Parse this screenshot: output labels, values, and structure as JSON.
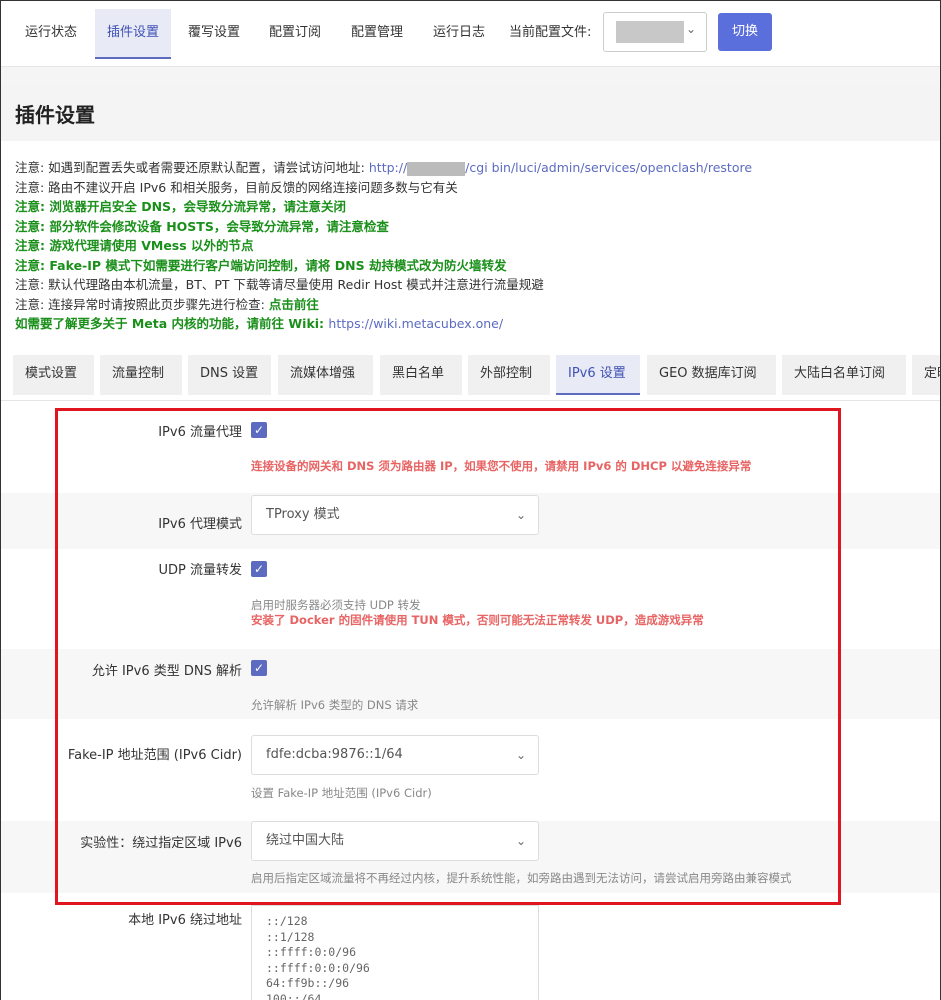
{
  "topnav": {
    "items": [
      "运行状态",
      "插件设置",
      "覆写设置",
      "配置订阅",
      "配置管理",
      "运行日志"
    ],
    "config_label": "当前配置文件:",
    "switch_label": "切换"
  },
  "page": {
    "title": "插件设置"
  },
  "notices": {
    "n1_prefix": "注意: 如遇到配置丢失或者需要还原默认配置，请尝试访问地址: ",
    "n1_link_a": "http://",
    "n1_link_b": "/cgi bin/luci/admin/services/openclash/restore",
    "n2": "注意: 路由不建议开启 IPv6 和相关服务，目前反馈的网络连接问题多数与它有关",
    "n3": "注意: 浏览器开启安全 DNS，会导致分流异常，请注意关闭",
    "n4": "注意: 部分软件会修改设备 HOSTS，会导致分流异常，请注意检查",
    "n5": "注意: 游戏代理请使用 VMess 以外的节点",
    "n6": "注意: Fake-IP 模式下如需要进行客户端访问控制，请将 DNS 劫持模式改为防火墙转发",
    "n7": "注意: 默认代理路由本机流量，BT、PT 下载等请尽量使用 Redir  Host 模式并注意进行流量规避",
    "n8_prefix": "注意: 连接异常时请按照此页步骤先进行检查: ",
    "n8_link": "点击前往",
    "n9_prefix": "如需要了解更多关于 Meta 内核的功能，请前往 Wiki: ",
    "n9_link": "https://wiki.metacubex.one/"
  },
  "tabs": [
    "模式设置",
    "流量控制",
    "DNS 设置",
    "流媒体增强",
    "黑白名单",
    "外部控制",
    "IPv6 设置",
    "GEO 数据库订阅",
    "大陆白名单订阅",
    "定时"
  ],
  "ipv6": {
    "proxy_label": "IPv6 流量代理",
    "proxy_hint": "连接设备的网关和 DNS 须为路由器 IP，如果您不使用，请禁用 IPv6 的 DHCP 以避免连接异常",
    "mode_label": "IPv6 代理模式",
    "mode_value": "TProxy 模式",
    "udp_label": "UDP 流量转发",
    "udp_hint1": "启用时服务器必须支持 UDP 转发",
    "udp_hint2": "安装了 Docker 的固件请使用 TUN 模式，否则可能无法正常转发 UDP，造成游戏异常",
    "dns_label": "允许 IPv6 类型 DNS 解析",
    "dns_hint": "允许解析 IPv6 类型的 DNS 请求",
    "fakeip_label": "Fake-IP 地址范围 (IPv6 Cidr)",
    "fakeip_value": "fdfe:dcba:9876::1/64",
    "fakeip_hint": "设置 Fake-IP 地址范围 (IPv6 Cidr)",
    "bypass_label": "实验性：绕过指定区域 IPv6",
    "bypass_value": "绕过中国大陆",
    "bypass_hint": "启用后指定区域流量将不再经过内核，提升系统性能，如旁路由遇到无法访问，请尝试启用旁路由兼容模式",
    "local_label": "本地 IPv6 绕过地址",
    "local_value": "::/128\n::1/128\n::ffff:0:0/96\n::ffff:0:0:0/96\n64:ff9b::/96\n100::/64"
  }
}
